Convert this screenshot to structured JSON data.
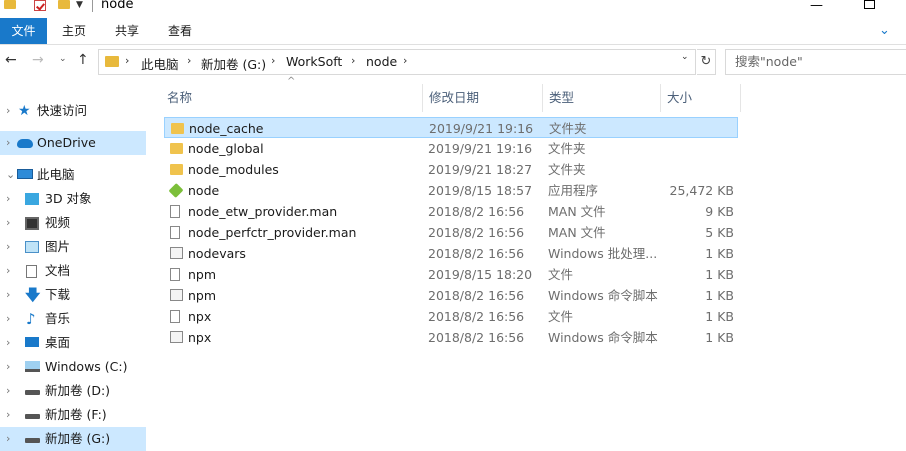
{
  "window": {
    "title": "node"
  },
  "quick_access_toolbar": [
    "folder-icon",
    "properties-check-icon",
    "new-folder-icon",
    "customize-dropdown"
  ],
  "ribbon": {
    "tabs": [
      {
        "label": "文件",
        "active": true
      },
      {
        "label": "主页"
      },
      {
        "label": "共享"
      },
      {
        "label": "查看"
      }
    ]
  },
  "address": {
    "breadcrumbs": [
      "此电脑",
      "新加卷 (G:)",
      "WorkSoft",
      "node"
    ]
  },
  "search": {
    "placeholder": "搜索\"node\""
  },
  "nav_pane": {
    "items": [
      {
        "label": "快速访问",
        "icon": "star-icon"
      },
      {
        "label": "OneDrive",
        "icon": "cloud-icon",
        "selected": true
      },
      {
        "label": "此电脑",
        "icon": "computer-icon"
      },
      {
        "label": "3D 对象",
        "icon": "3d-objects-icon"
      },
      {
        "label": "视频",
        "icon": "video-icon"
      },
      {
        "label": "图片",
        "icon": "pictures-icon"
      },
      {
        "label": "文档",
        "icon": "documents-icon"
      },
      {
        "label": "下载",
        "icon": "downloads-icon"
      },
      {
        "label": "音乐",
        "icon": "music-icon"
      },
      {
        "label": "桌面",
        "icon": "desktop-icon"
      },
      {
        "label": "Windows (C:)",
        "icon": "drive-c-icon"
      },
      {
        "label": "新加卷 (D:)",
        "icon": "drive-icon"
      },
      {
        "label": "新加卷 (F:)",
        "icon": "drive-icon"
      },
      {
        "label": "新加卷 (G:)",
        "icon": "drive-icon",
        "selected": true
      }
    ]
  },
  "file_list": {
    "columns": {
      "name": "名称",
      "date": "修改日期",
      "type": "类型",
      "size": "大小"
    },
    "rows": [
      {
        "name": "node_cache",
        "date": "2019/9/21 19:16",
        "type": "文件夹",
        "size": "",
        "icon": "folder-icon",
        "selected": true
      },
      {
        "name": "node_global",
        "date": "2019/9/21 19:16",
        "type": "文件夹",
        "size": "",
        "icon": "folder-icon"
      },
      {
        "name": "node_modules",
        "date": "2019/9/21 18:27",
        "type": "文件夹",
        "size": "",
        "icon": "folder-icon"
      },
      {
        "name": "node",
        "date": "2019/8/15 18:57",
        "type": "应用程序",
        "size": "25,472 KB",
        "icon": "nodejs-icon"
      },
      {
        "name": "node_etw_provider.man",
        "date": "2018/8/2 16:56",
        "type": "MAN 文件",
        "size": "9 KB",
        "icon": "file-icon"
      },
      {
        "name": "node_perfctr_provider.man",
        "date": "2018/8/2 16:56",
        "type": "MAN 文件",
        "size": "5 KB",
        "icon": "file-icon"
      },
      {
        "name": "nodevars",
        "date": "2018/8/2 16:56",
        "type": "Windows 批处理...",
        "size": "1 KB",
        "icon": "batch-file-icon"
      },
      {
        "name": "npm",
        "date": "2019/8/15 18:20",
        "type": "文件",
        "size": "1 KB",
        "icon": "file-icon"
      },
      {
        "name": "npm",
        "date": "2018/8/2 16:56",
        "type": "Windows 命令脚本",
        "size": "1 KB",
        "icon": "batch-file-icon"
      },
      {
        "name": "npx",
        "date": "2018/8/2 16:56",
        "type": "文件",
        "size": "1 KB",
        "icon": "file-icon"
      },
      {
        "name": "npx",
        "date": "2018/8/2 16:56",
        "type": "Windows 命令脚本",
        "size": "1 KB",
        "icon": "batch-file-icon"
      }
    ]
  },
  "colors": {
    "accent": "#1979ca",
    "selection": "#cce8ff",
    "folder": "#f0c34d"
  }
}
